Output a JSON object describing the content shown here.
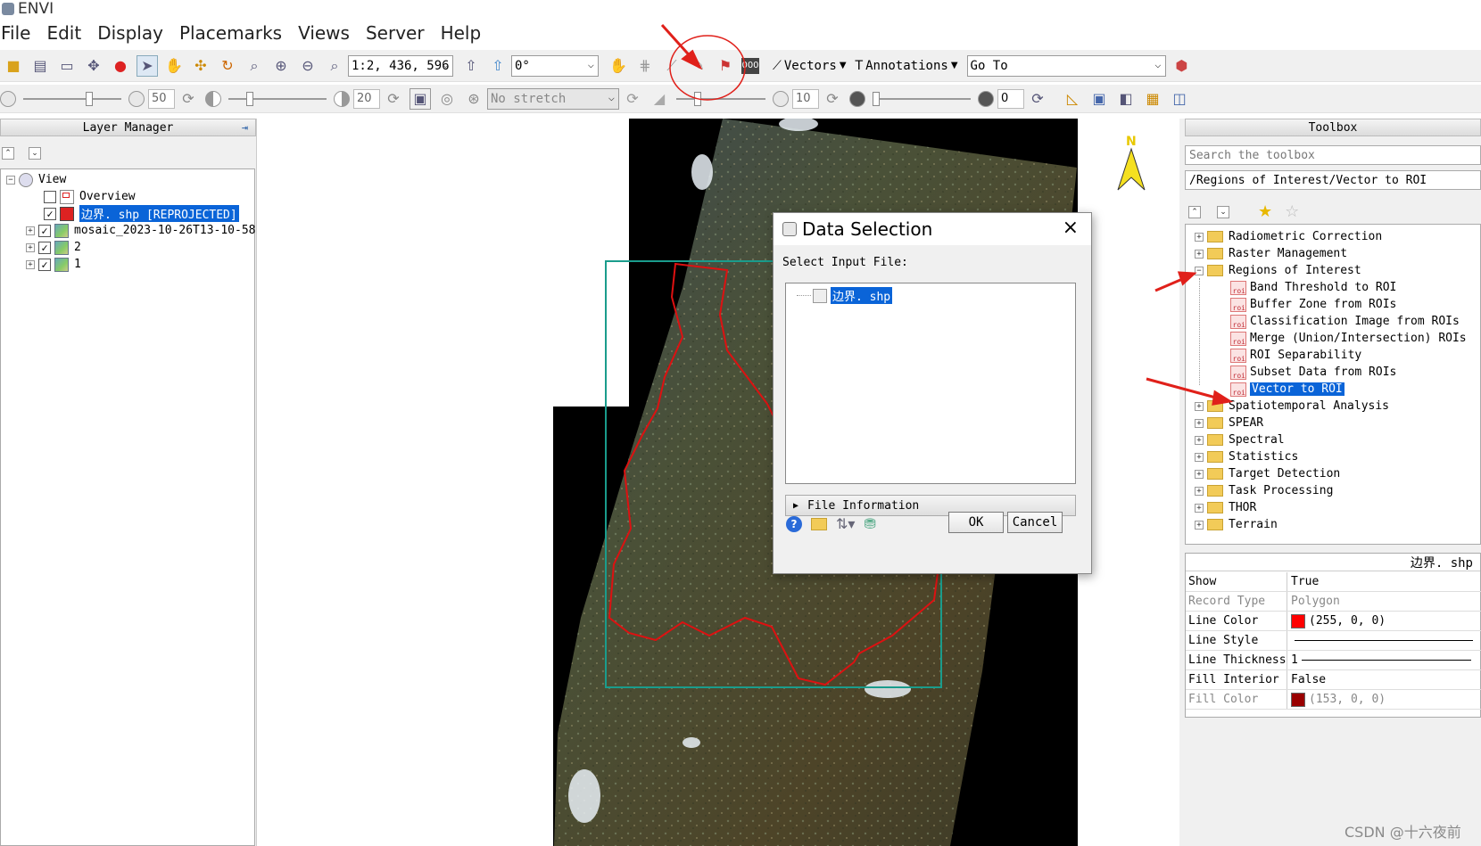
{
  "app": {
    "title": "ENVI"
  },
  "menu": [
    "File",
    "Edit",
    "Display",
    "Placemarks",
    "Views",
    "Server",
    "Help"
  ],
  "toolbar1": {
    "scale_value": "1:2, 436, 596",
    "rotation_value": "0°",
    "vectors_label": "Vectors",
    "annotations_label": "Annotations",
    "goto_placeholder": "Go To"
  },
  "toolbar2": {
    "brightness_value": "50",
    "contrast_value": "20",
    "stretch_value": "No stretch",
    "sharpen_value": "10",
    "transparency_value": "0"
  },
  "layer_manager": {
    "title": "Layer Manager",
    "tree": [
      {
        "label": "View"
      },
      {
        "label": "Overview"
      },
      {
        "label": "边界. shp [REPROJECTED]"
      },
      {
        "label": "mosaic_2023-10-26T13-10-58"
      },
      {
        "label": "2"
      },
      {
        "label": "1"
      }
    ]
  },
  "toolbox": {
    "title": "Toolbox",
    "search_placeholder": "Search the toolbox",
    "path": "/Regions of Interest/Vector to ROI",
    "folders": [
      {
        "label": "Radiometric Correction"
      },
      {
        "label": "Raster Management"
      },
      {
        "label": "Regions of Interest"
      },
      {
        "label": "Spatiotemporal Analysis"
      },
      {
        "label": "SPEAR"
      },
      {
        "label": "Spectral"
      },
      {
        "label": "Statistics"
      },
      {
        "label": "Target Detection"
      },
      {
        "label": "Task Processing"
      },
      {
        "label": "THOR"
      },
      {
        "label": "Terrain"
      }
    ],
    "roi_tools": [
      {
        "label": "Band Threshold to ROI"
      },
      {
        "label": "Buffer Zone from ROIs"
      },
      {
        "label": "Classification Image from ROIs"
      },
      {
        "label": "Merge (Union/Intersection) ROIs"
      },
      {
        "label": "ROI Separability"
      },
      {
        "label": "Subset Data from ROIs"
      },
      {
        "label": "Vector to ROI"
      }
    ]
  },
  "properties": {
    "header": "边界. shp",
    "rows": [
      {
        "key": "Show",
        "value": "True"
      },
      {
        "key": "Record Type",
        "value": "Polygon"
      },
      {
        "key": "Line Color",
        "value": "(255, 0, 0)"
      },
      {
        "key": "Line Style",
        "value": ""
      },
      {
        "key": "Line Thickness",
        "value": "1"
      },
      {
        "key": "Fill Interior",
        "value": "False"
      },
      {
        "key": "Fill Color",
        "value": "(153, 0, 0)"
      }
    ],
    "line_color_hex": "#ff0000",
    "fill_color_hex": "#990000"
  },
  "dialog": {
    "title": "Data Selection",
    "label": "Select Input File:",
    "files": [
      "边界. shp"
    ],
    "info_label": "File Information",
    "ok_label": "OK",
    "cancel_label": "Cancel"
  },
  "map": {
    "north_label": "N"
  },
  "watermark": "CSDN @十六夜前",
  "colors": {
    "selection": "#0a64d8",
    "annotation_red": "#e0201a",
    "boundary_red": "#dd1111",
    "extent_teal": "#1a9c8c"
  }
}
